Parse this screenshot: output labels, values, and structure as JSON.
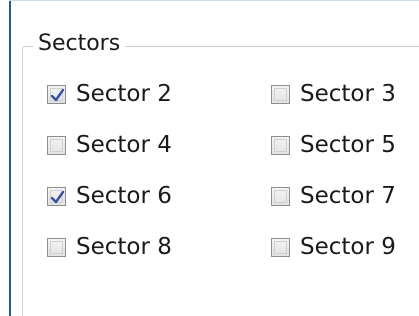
{
  "group": {
    "title": "Sectors"
  },
  "checkboxes": [
    {
      "label": "Sector 2",
      "checked": true
    },
    {
      "label": "Sector 3",
      "checked": false
    },
    {
      "label": "Sector 4",
      "checked": false
    },
    {
      "label": "Sector 5",
      "checked": false
    },
    {
      "label": "Sector 6",
      "checked": true
    },
    {
      "label": "Sector 7",
      "checked": false
    },
    {
      "label": "Sector 8",
      "checked": false
    },
    {
      "label": "Sector 9",
      "checked": false
    }
  ],
  "colors": {
    "checkmark": "#3a4fa0",
    "window_frame": "#1f5f8f"
  }
}
